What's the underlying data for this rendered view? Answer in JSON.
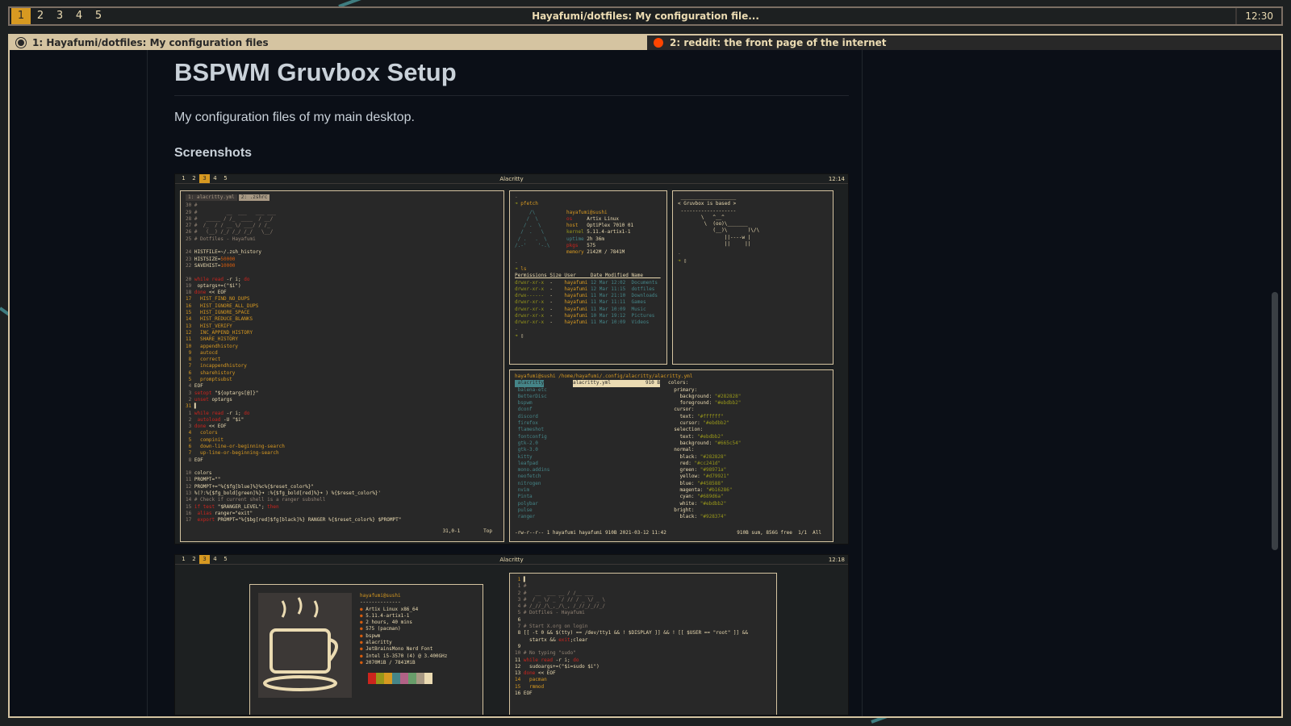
{
  "topbar": {
    "workspaces": [
      "1",
      "2",
      "3",
      "4",
      "5"
    ],
    "active_workspace": "1",
    "title": "Hayafumi/dotfiles: My configuration file...",
    "clock": "12:30"
  },
  "browser": {
    "tabs": [
      {
        "label": "1: Hayafumi/dotfiles: My configuration files",
        "icon": "github-icon"
      },
      {
        "label": "2: reddit: the front page of the internet",
        "icon": "reddit-icon"
      }
    ]
  },
  "readme": {
    "title": "BSPWM Gruvbox Setup",
    "description": "My configuration files of my main desktop.",
    "screenshots_heading": "Screenshots"
  },
  "shot1": {
    "workspaces": [
      "1",
      "2",
      "3",
      "4",
      "5"
    ],
    "active_workspace": "3",
    "title": "Alacritty",
    "clock": "12:14",
    "vim_tabs": [
      "1: alacritty.yml",
      "2: .zshrc"
    ],
    "vim_status": "31,0-1",
    "vim_pos": "Top",
    "pfetch": {
      "prompt": "pfetch",
      "user": "hayafumi@sushi",
      "os": "Artix Linux",
      "host": "OptiPlex 7010 01",
      "kernel": "5.11.4-artix1-1",
      "uptime": "2h 36m",
      "pkgs": "575",
      "memory": "2142M / 7841M"
    },
    "ls": {
      "prompt": "ls",
      "headers": [
        "Permissions",
        "Size",
        "User",
        "Date Modified",
        "Name"
      ],
      "rows": [
        [
          "drwxr-xr-x",
          "-",
          "hayafumi",
          "12 Mar 12:02",
          "Documents"
        ],
        [
          "drwxr-xr-x",
          "-",
          "hayafumi",
          "12 Mar 11:15",
          "dotfiles"
        ],
        [
          "drwx------",
          "-",
          "hayafumi",
          "11 Mar 21:10",
          "Downloads"
        ],
        [
          "drwxr-xr-x",
          "-",
          "hayafumi",
          "11 Mar 11:11",
          "Games"
        ],
        [
          "drwxr-xr-x",
          "-",
          "hayafumi",
          "11 Mar 10:09",
          "Music"
        ],
        [
          "drwxr-xr-x",
          "-",
          "hayafumi",
          "10 Mar 19:12",
          "Pictures"
        ],
        [
          "drwxr-xr-x",
          "-",
          "hayafumi",
          "11 Mar 10:09",
          "Videos"
        ]
      ]
    },
    "cowsay": "< Gruvbox is based >",
    "ranger": {
      "path": "hayafumi@sushi /home/hayafumi/.config/alacritty/alacritty.yml",
      "dirs": [
        "alacritty",
        "balena-etc",
        "BetterDisc",
        "bspwm",
        "dconf",
        "discord",
        "firefox",
        "flameshot",
        "fontconfig",
        "gtk-2.0",
        "gtk-3.0",
        "kitty",
        "leafpad",
        "mono.addins",
        "neofetch",
        "nitrogen",
        "nvim",
        "Pinta",
        "polybar",
        "pulse",
        "ranger"
      ],
      "file": "alacritty.yml",
      "file_size": "910 B",
      "footer": "-rw-r--r-- 1 hayafumi hayafumi 910B 2021-03-12 11:42",
      "footer_right": "910B sum, 856G free  1/1  All"
    }
  },
  "shot2": {
    "workspaces": [
      "1",
      "2",
      "3",
      "4",
      "5"
    ],
    "active_workspace": "3",
    "title": "Alacritty",
    "clock": "12:18",
    "neofetch": {
      "user": "hayafumi@sushi",
      "lines": [
        "Artix Linux x86_64",
        "5.11.4-artix1-1",
        "2 hours, 40 mins",
        "575 (pacman)",
        "bspwm",
        "alacritty",
        "JetBrainsMono Nerd Font",
        "Intel i5-3570 (4) @ 3.400GHz",
        "2070MiB / 7841MiB"
      ]
    },
    "palette": [
      "#282828",
      "#cc241d",
      "#98971a",
      "#d79921",
      "#458588",
      "#b16286",
      "#689d6a",
      "#a89984",
      "#ebdbb2"
    ]
  }
}
